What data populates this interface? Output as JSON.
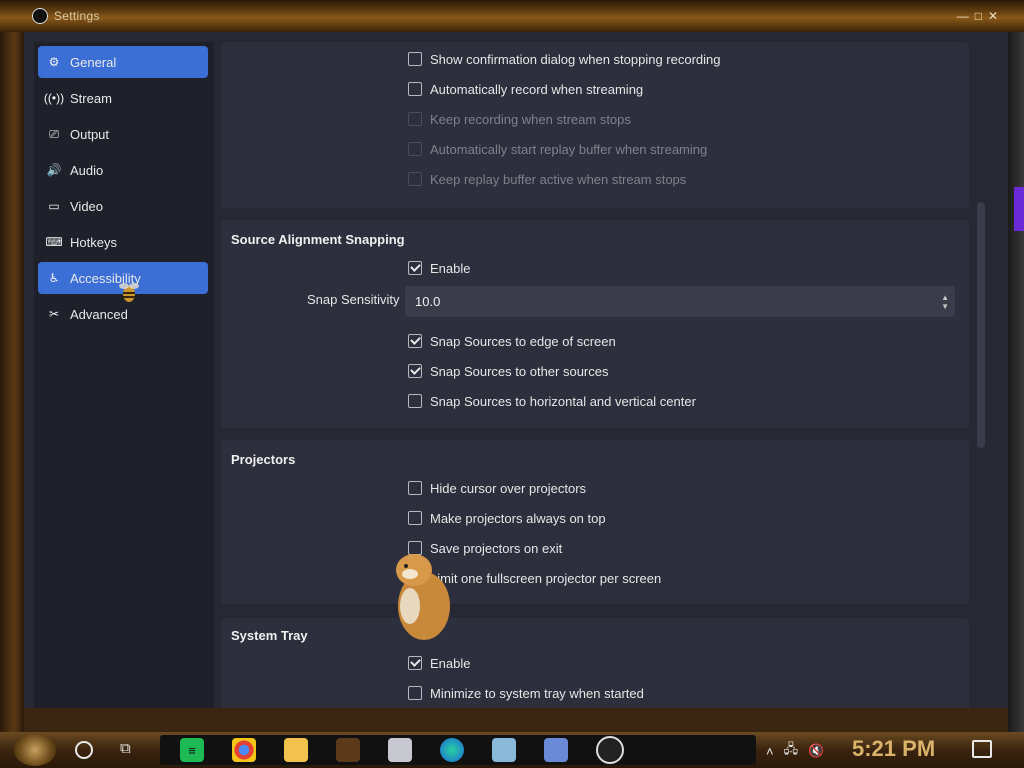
{
  "window": {
    "title": "Settings"
  },
  "sidebar": {
    "items": [
      {
        "label": "General",
        "icon": "gear-icon",
        "active": true
      },
      {
        "label": "Stream",
        "icon": "antenna-icon",
        "active": false
      },
      {
        "label": "Output",
        "icon": "output-icon",
        "active": false
      },
      {
        "label": "Audio",
        "icon": "speaker-icon",
        "active": false
      },
      {
        "label": "Video",
        "icon": "monitor-icon",
        "active": false
      },
      {
        "label": "Hotkeys",
        "icon": "keyboard-icon",
        "active": false
      },
      {
        "label": "Accessibility",
        "icon": "accessibility-icon",
        "active": true
      },
      {
        "label": "Advanced",
        "icon": "wrench-icon",
        "active": false
      }
    ]
  },
  "recording_options": [
    {
      "label": "Show confirmation dialog when stopping recording",
      "checked": false,
      "enabled": true
    },
    {
      "label": "Automatically record when streaming",
      "checked": false,
      "enabled": true
    },
    {
      "label": "Keep recording when stream stops",
      "checked": false,
      "enabled": false
    },
    {
      "label": "Automatically start replay buffer when streaming",
      "checked": false,
      "enabled": false
    },
    {
      "label": "Keep replay buffer active when stream stops",
      "checked": false,
      "enabled": false
    }
  ],
  "snapping": {
    "title": "Source Alignment Snapping",
    "enable_label": "Enable",
    "enable_checked": true,
    "sensitivity_label": "Snap Sensitivity",
    "sensitivity_value": "10.0",
    "options": [
      {
        "label": "Snap Sources to edge of screen",
        "checked": true
      },
      {
        "label": "Snap Sources to other sources",
        "checked": true
      },
      {
        "label": "Snap Sources to horizontal and vertical center",
        "checked": false
      }
    ]
  },
  "projectors": {
    "title": "Projectors",
    "options": [
      {
        "label": "Hide cursor over projectors",
        "checked": false
      },
      {
        "label": "Make projectors always on top",
        "checked": false
      },
      {
        "label": "Save projectors on exit",
        "checked": false
      },
      {
        "label": "Limit one fullscreen projector per screen",
        "checked": false
      }
    ]
  },
  "system_tray": {
    "title": "System Tray",
    "options": [
      {
        "label": "Enable",
        "checked": true
      },
      {
        "label": "Minimize to system tray when started",
        "checked": false
      }
    ]
  },
  "taskbar": {
    "clock": "5:21 PM",
    "apps": [
      "spotify-icon",
      "chrome-icon",
      "file-explorer-icon",
      "app-icon",
      "app-icon",
      "edge-icon",
      "app-icon",
      "app-icon",
      "obs-icon"
    ]
  },
  "colors": {
    "accent": "#3c6fd6",
    "window_bg": "#262833",
    "group_bg": "#2d2f3c",
    "clock": "#d9b36a"
  }
}
